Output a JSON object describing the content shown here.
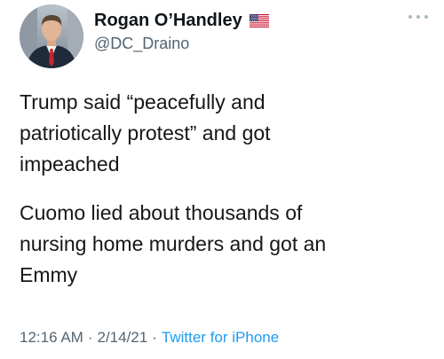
{
  "author": {
    "display_name": "Rogan O’Handley",
    "handle": "@DC_Draino",
    "flag_icon": "us-flag-icon",
    "avatar_icon": "profile-avatar"
  },
  "tweet": {
    "paragraphs": [
      "Trump said “peacefully and\npatriotically protest” and got\nimpeached",
      "Cuomo lied about thousands of\nnursing home murders and got an\nEmmy"
    ]
  },
  "meta": {
    "time": "12:16 AM",
    "separator": "·",
    "date": "2/14/21",
    "source": "Twitter for iPhone"
  },
  "menu": {
    "more_icon": "more-options-icon"
  },
  "colors": {
    "text": "#14171a",
    "secondary": "#536471",
    "link": "#1d9bf0"
  }
}
